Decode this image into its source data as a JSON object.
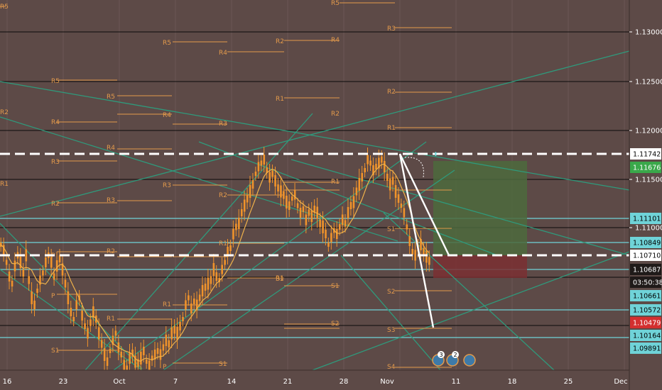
{
  "chart": {
    "date_axis": {
      "labels": [
        "16",
        "23",
        "Oct",
        "7",
        "14",
        "21",
        "28",
        "Nov",
        "11",
        "18",
        "25",
        "Dec"
      ]
    },
    "price_axis": {
      "ticks": [
        "1.13000",
        "1.12500",
        "1.12000",
        "1.11500",
        "1.11000"
      ],
      "tags": [
        {
          "text": "1.11742",
          "style": "dashed-white"
        },
        {
          "text": "1.11676",
          "style": "green"
        },
        {
          "text": "1.11101",
          "style": "cyan"
        },
        {
          "text": "1.10849",
          "style": "cyan"
        },
        {
          "text": "1.10710",
          "style": "dashed-white"
        },
        {
          "text": "1.10687",
          "style": "dark"
        },
        {
          "text": "03:50:38",
          "style": "dark"
        },
        {
          "text": "1.10661",
          "style": "cyan"
        },
        {
          "text": "1.10572",
          "style": "cyan"
        },
        {
          "text": "1.10479",
          "style": "red"
        },
        {
          "text": "1.10164",
          "style": "cyan"
        },
        {
          "text": "1.09891",
          "style": "cyan"
        }
      ]
    },
    "pivot_labels": [
      {
        "text": "R5"
      },
      {
        "text": "R4"
      },
      {
        "text": "R3"
      },
      {
        "text": "R2"
      },
      {
        "text": "R1"
      },
      {
        "text": "P"
      },
      {
        "text": "S1"
      },
      {
        "text": "S2"
      },
      {
        "text": "S3"
      },
      {
        "text": "S4"
      }
    ],
    "event_badges": [
      {
        "text": "3",
        "icon": "news-badge-icon"
      },
      {
        "text": "2",
        "icon": "news-badge-icon"
      },
      {
        "text": "",
        "icon": "globe-icon"
      }
    ],
    "colors": {
      "background": "#5d4a47",
      "pivot": "#e39a4b",
      "candle": "#f0932b",
      "teal_line": "#2f9a7c",
      "cyan_level": "#6fd3d8",
      "green_zone": "#4c6a3d",
      "red_zone": "#7a2f32"
    }
  }
}
